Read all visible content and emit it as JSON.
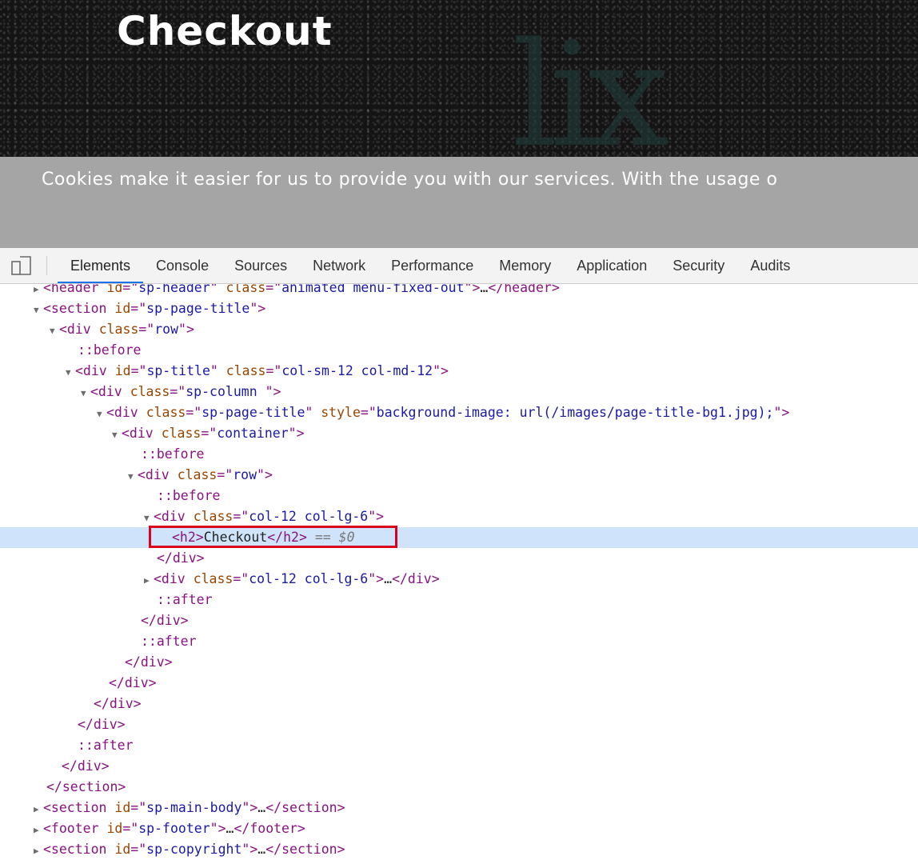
{
  "page": {
    "title": "Checkout",
    "cookie_text": "Cookies make it easier for us to provide you with our services. With the usage o"
  },
  "devtools": {
    "tabs": [
      "Elements",
      "Console",
      "Sources",
      "Network",
      "Performance",
      "Memory",
      "Application",
      "Security",
      "Audits"
    ],
    "active_tab": "Elements"
  },
  "tree": {
    "header_id": "sp-header",
    "header_class": "animated menu-fixed-out",
    "section_id": "sp-page-title",
    "row_class": "row",
    "title_div_id": "sp-title",
    "title_div_class": "col-sm-12 col-md-12",
    "column_class": "sp-column ",
    "page_title_class": "sp-page-title",
    "page_title_style": "background-image: url(/images/page-title-bg1.jpg);",
    "container_class": "container",
    "col_class": "col-12 col-lg-6",
    "h2_text": "Checkout",
    "selected_marker": "== $0",
    "main_body_id": "sp-main-body",
    "footer_id": "sp-footer",
    "copyright_id": "sp-copyright",
    "before": "::before",
    "after": "::after",
    "ellipsis": "…"
  },
  "colors": {
    "tag": "#881280",
    "attribute": "#994500",
    "value": "#1a1aa6",
    "selected_row": "#cfe4fa",
    "highlight_box": "#d8001c"
  }
}
